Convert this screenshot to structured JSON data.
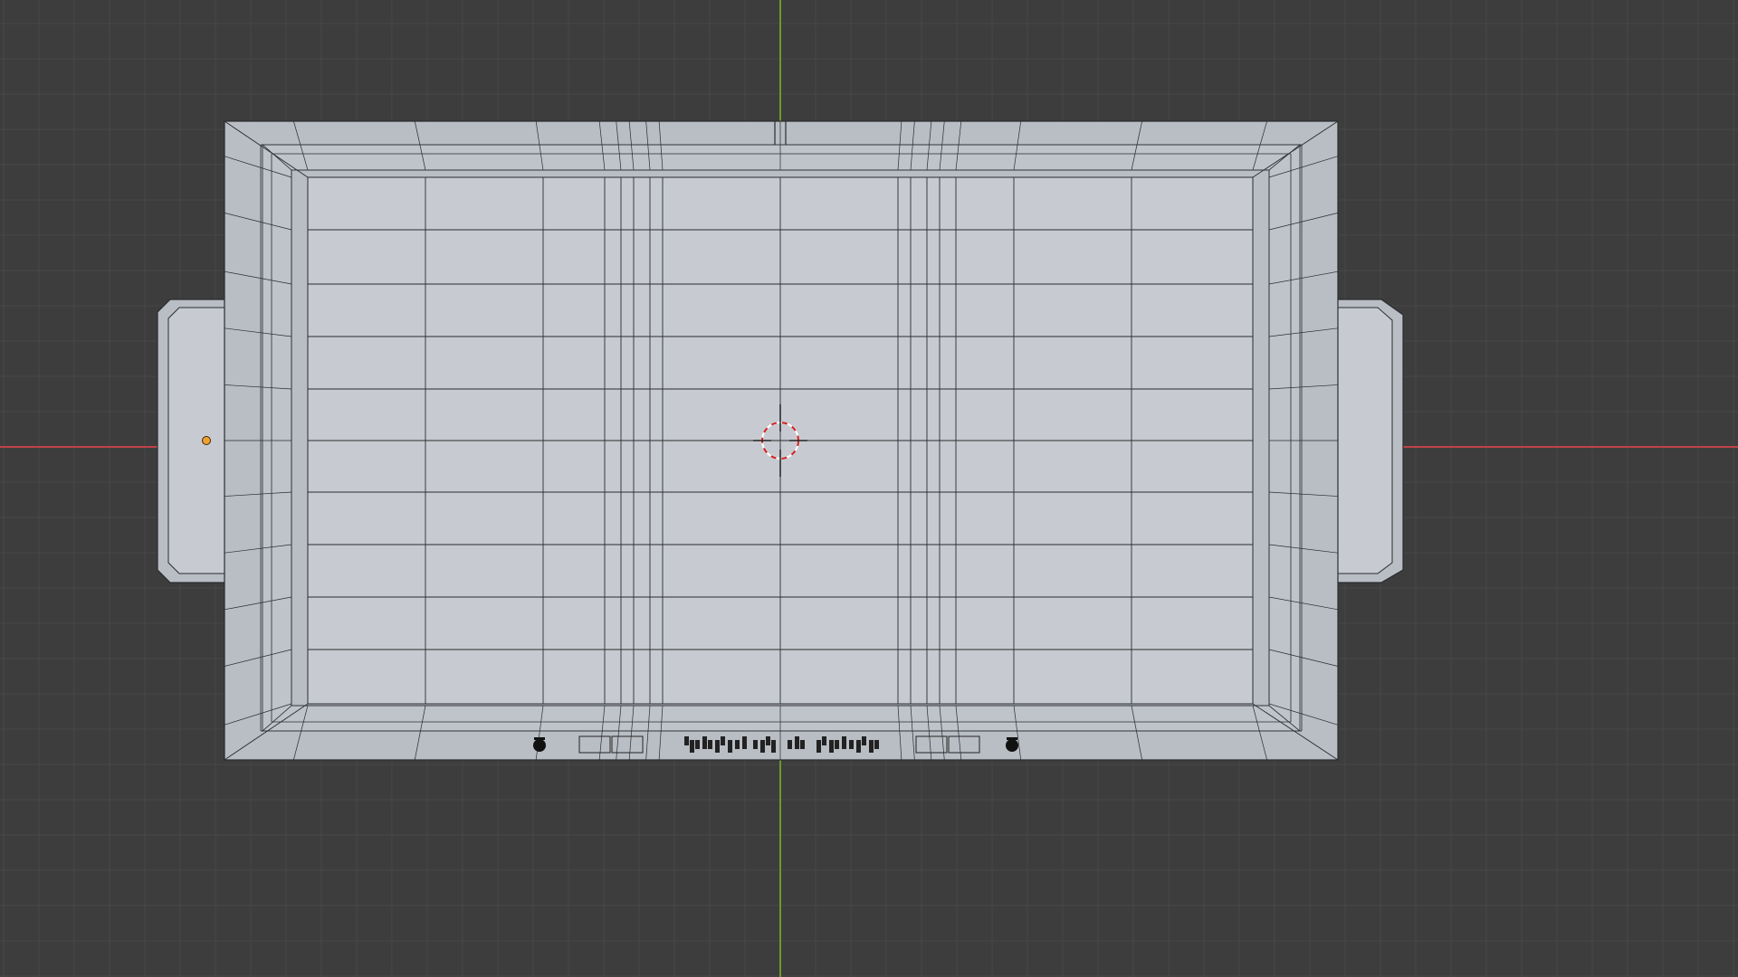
{
  "viewport": {
    "view": "top-orthographic",
    "background_color": "#3d3d3d",
    "grid_minor_color": "#484848",
    "grid_major_color": "#525252",
    "x_axis_color": "#c0424a",
    "y_axis_color": "#6a9c2a"
  },
  "model": {
    "object": "tray-with-handles",
    "display": "solid-with-wireframe-overlay",
    "surface_color": "#c7cbd1",
    "rim_color": "#b9bdc4",
    "edge_color": "#2a2c30"
  },
  "scene": {
    "cursor_icon": "3d-cursor-icon",
    "origin_icon": "object-origin-icon",
    "origin_color": "#f0a030"
  }
}
